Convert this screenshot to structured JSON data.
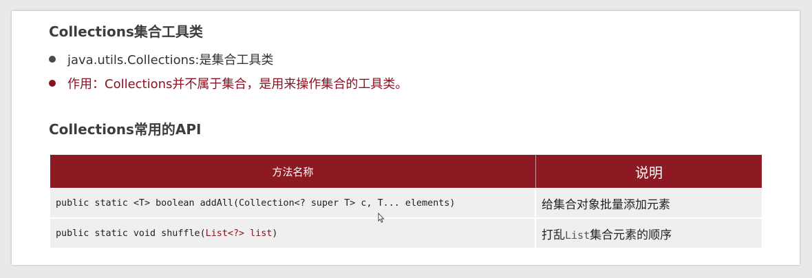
{
  "heading1": "Collections集合工具类",
  "bullets": [
    "java.utils.Collections:是集合工具类",
    "作用：Collections并不属于集合，是用来操作集合的工具类。"
  ],
  "heading2": "Collections常用的API",
  "table": {
    "headers": [
      "方法名称",
      "说明"
    ],
    "rows": [
      {
        "signature": "public static <T> boolean addAll(Collection<? super T> c, T... elements)",
        "description": "给集合对象批量添加元素"
      },
      {
        "signature_prefix": "public static void shuffle(",
        "signature_param": "List<?> list",
        "signature_suffix": ")",
        "description_pre": "打乱",
        "description_code": "List",
        "description_post": "集合元素的顺序"
      }
    ]
  },
  "colors": {
    "accent": "#8d1a23",
    "bullet_red": "#8b1020"
  }
}
